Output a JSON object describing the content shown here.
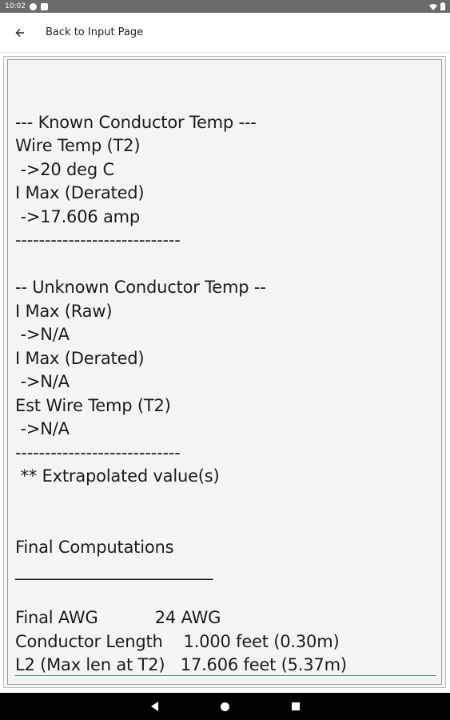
{
  "status_bar": {
    "time": "10:02",
    "left_icons": [
      "sync-icon",
      "sd-card-icon"
    ],
    "right_icons": [
      "wifi-icon",
      "battery-icon"
    ]
  },
  "app_bar": {
    "back_icon": "arrow-left-icon",
    "title": "Back to Input Page"
  },
  "results": {
    "lines": [
      "",
      "--- Known Conductor Temp ---",
      "Wire Temp (T2)",
      " ->20 deg C",
      "I Max (Derated)",
      " ->17.606 amp",
      "----------------------------",
      "",
      "-- Unknown Conductor Temp --",
      "I Max (Raw)",
      " ->N/A",
      "I Max (Derated)",
      " ->N/A",
      "Est Wire Temp (T2)",
      " ->N/A",
      "----------------------------",
      " ** Extrapolated value(s)",
      "",
      "",
      "Final Computations",
      "________________________",
      "",
      "Final AWG           24 AWG",
      "Conductor Length    1.000 feet (0.30m)",
      "L2 (Max len at T2)   17.606 feet (5.37m)"
    ]
  },
  "nav_bar": {
    "buttons": [
      "back-nav",
      "home-nav",
      "recents-nav"
    ]
  }
}
